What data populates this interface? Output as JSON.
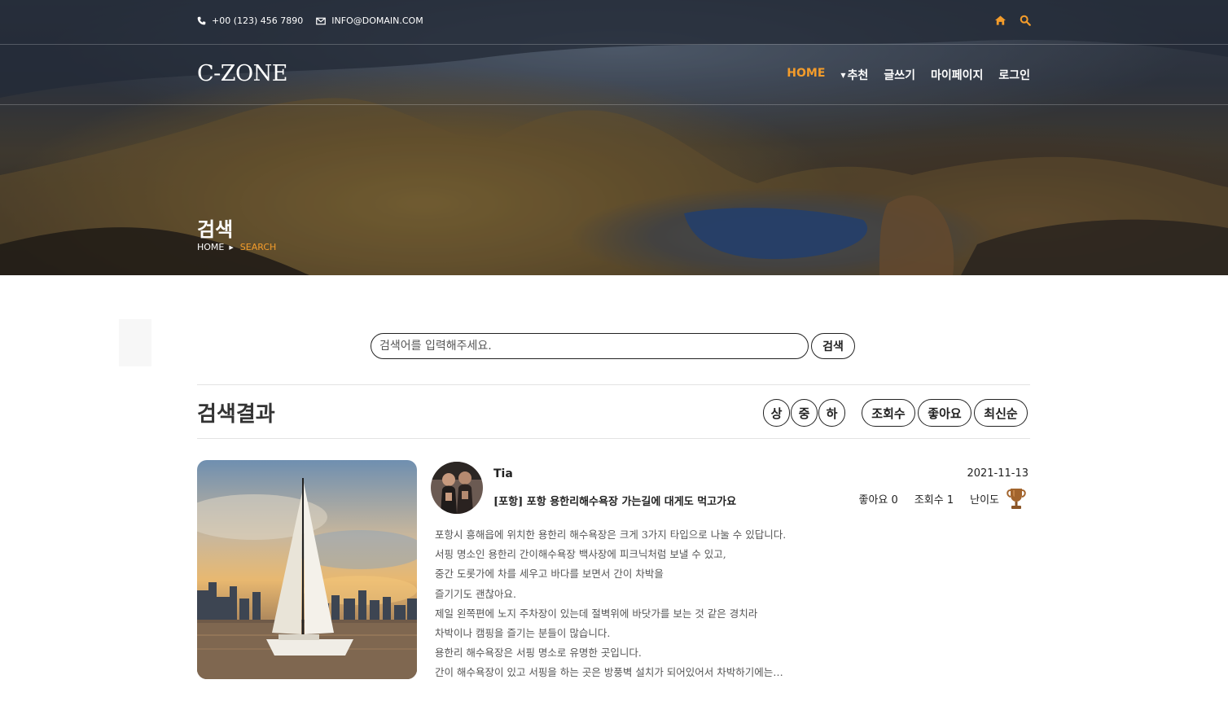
{
  "topbar": {
    "phone": "+00 (123) 456 7890",
    "email": "INFO@DOMAIN.COM",
    "icons": [
      "phone-icon",
      "mail-icon",
      "home-icon",
      "search-icon"
    ]
  },
  "navbar": {
    "brand": "C-ZONE",
    "menu": {
      "home": "HOME",
      "recommend": "추천",
      "write": "글쓰기",
      "mypage": "마이페이지",
      "login": "로그인"
    }
  },
  "hero": {
    "title": "검색",
    "breadcrumb": {
      "home": "HOME",
      "current": "SEARCH"
    }
  },
  "search": {
    "placeholder": "검색어를 입력해주세요.",
    "button": "검색"
  },
  "results": {
    "title": "검색결과",
    "difficulty_filters": [
      "상",
      "중",
      "하"
    ],
    "sort_options": [
      "조회수",
      "좋아요",
      "최신순"
    ]
  },
  "post": {
    "author": "Tia",
    "date": "2021-11-13",
    "title": "[포항] 포항 용한리해수욕장 가는길에 대게도 먹고가요",
    "likes_label": "좋아요 0",
    "views_label": "조회수 1",
    "difficulty_label": "난이도",
    "difficulty_icon": "trophy-icon",
    "body_lines": [
      "포항시 흥해읍에 위치한 용한리 해수욕장은 크게 3가지 타입으로 나눌 수 있답니다.",
      "서핑 명소인 용한리 간이해수욕장 백사장에 피크닉처럼 보낼 수 있고,",
      "중간 도롯가에 차를 세우고 바다를 보면서 간이 차박을",
      "즐기기도 괜찮아요.",
      "제일 왼쪽편에 노지 주차장이 있는데 절벽위에 바닷가를 보는 것 같은 경치라",
      "차박이나 캠핑을 즐기는 분들이 많습니다.",
      "용한리 해수욕장은 서핑 명소로 유명한 곳입니다.",
      "간이 해수욕장이 있고 서핑을 하는 곳은 방풍벽 설치가 되어있어서 차박하기에는…"
    ]
  },
  "colors": {
    "accent": "#f39c2b",
    "text": "#333333",
    "divider": "#e3e3e3"
  }
}
